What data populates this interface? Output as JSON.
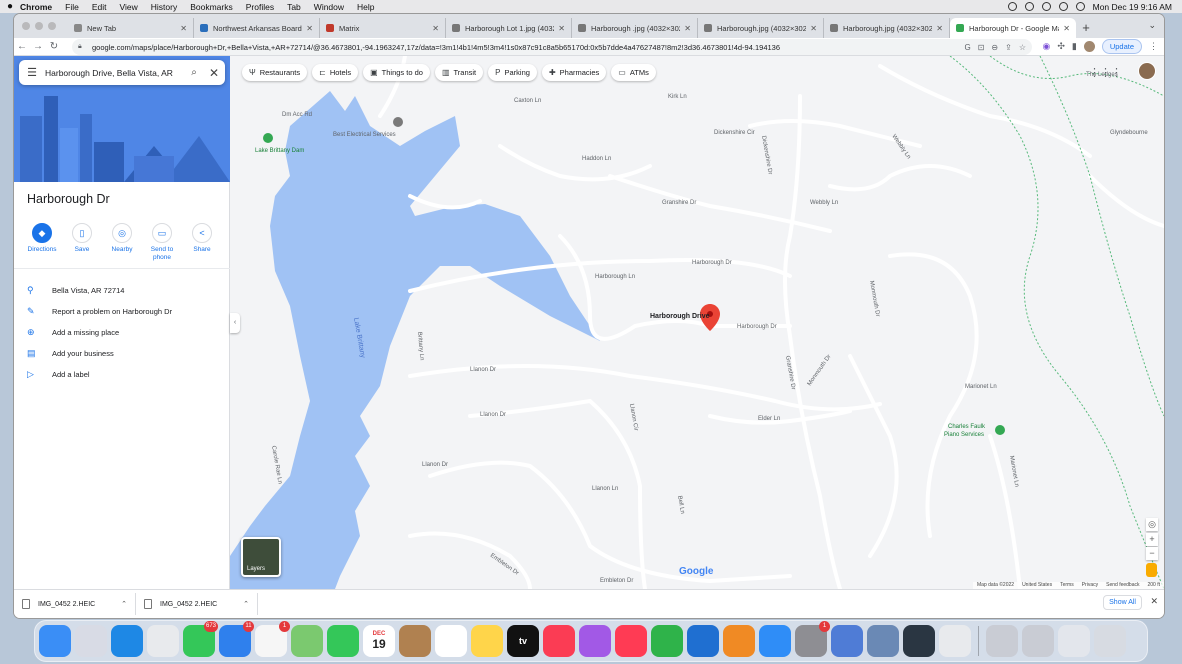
{
  "menubar": {
    "apple": "",
    "items": [
      "Chrome",
      "File",
      "Edit",
      "View",
      "History",
      "Bookmarks",
      "Profiles",
      "Tab",
      "Window",
      "Help"
    ],
    "clock": "Mon Dec 19  9:16 AM"
  },
  "browser": {
    "tabs": [
      {
        "title": "New Tab",
        "color": "#888888"
      },
      {
        "title": "Northwest Arkansas Board of R",
        "color": "#2a6ebb"
      },
      {
        "title": "Matrix",
        "color": "#c0392b"
      },
      {
        "title": "Harborough Lot 1.jpg (4032×3",
        "color": "#777777"
      },
      {
        "title": "Harborough .jpg (4032×3024)",
        "color": "#777777"
      },
      {
        "title": "Harborough.jpg (4032×3024)",
        "color": "#777777"
      },
      {
        "title": "Harborough.jpg (4032×3024)",
        "color": "#777777"
      },
      {
        "title": "Harborough Dr - Google Maps",
        "color": "#34a853",
        "active": true
      }
    ],
    "url": "google.com/maps/place/Harborough+Dr,+Bella+Vista,+AR+72714/@36.4673801,-94.1963247,17z/data=!3m1!4b1!4m5!3m4!1s0x87c91c8a5b65170d:0x5b7dde4a47627487!8m2!3d36.4673801!4d-94.194136",
    "update_label": "Update"
  },
  "maps": {
    "search_value": "Harborough Drive, Bella Vista, AR",
    "place_title": "Harborough Dr",
    "actions": [
      {
        "label": "Directions",
        "icon": "directions-icon",
        "glyph": "◆",
        "primary": true
      },
      {
        "label": "Save",
        "icon": "bookmark-icon",
        "glyph": "▯"
      },
      {
        "label": "Nearby",
        "icon": "nearby-icon",
        "glyph": "◎"
      },
      {
        "label": "Send to phone",
        "icon": "phone-icon",
        "glyph": "▭"
      },
      {
        "label": "Share",
        "icon": "share-icon",
        "glyph": "<"
      }
    ],
    "info": [
      {
        "label": "Bella Vista, AR 72714",
        "icon": "location-pin-icon",
        "glyph": "⚲"
      },
      {
        "label": "Report a problem on Harborough Dr",
        "icon": "pencil-icon",
        "glyph": "✎"
      },
      {
        "label": "Add a missing place",
        "icon": "add-place-icon",
        "glyph": "⊕"
      },
      {
        "label": "Add your business",
        "icon": "business-icon",
        "glyph": "▤"
      },
      {
        "label": "Add a label",
        "icon": "label-icon",
        "glyph": "▷"
      }
    ],
    "chips": [
      {
        "label": "Restaurants",
        "icon": "restaurant-icon",
        "glyph": "Ψ"
      },
      {
        "label": "Hotels",
        "icon": "hotel-icon",
        "glyph": "⊏"
      },
      {
        "label": "Things to do",
        "icon": "camera-icon",
        "glyph": "▣"
      },
      {
        "label": "Transit",
        "icon": "transit-icon",
        "glyph": "▥"
      },
      {
        "label": "Parking",
        "icon": "parking-icon",
        "glyph": "P"
      },
      {
        "label": "Pharmacies",
        "icon": "pharmacy-icon",
        "glyph": "✚"
      },
      {
        "label": "ATMs",
        "icon": "atm-icon",
        "glyph": "▭"
      }
    ],
    "map_labels": {
      "harborough_drive": "Harborough Drive",
      "harborough_dr": "Harborough Dr",
      "harborough_ln": "Harborough Ln",
      "lake_brittany": "Lake Brittany",
      "lake_brittany_dam": "Lake Brittany Dam",
      "best_electrical": "Best Electrical Services",
      "charles_faulk": "Charles Faulk",
      "piano_services": "Piano Services",
      "granshire_dr": "Granshire Dr",
      "granshire_dr2": "Granshire Dr",
      "haddon_ln": "Haddon Ln",
      "dickenshire_cir": "Dickenshire Cir",
      "dickenshire_dr": "Dickenshire Dr",
      "llanon_dr": "Llanon Dr",
      "llanon_dr2": "Llanon Dr",
      "llanon_dr3": "Llanon Dr",
      "llanon_ln": "Llanon Ln",
      "llanon_cir": "Llanon Cir",
      "elder_ln": "Elder Ln",
      "webbly_ln": "Webbly Ln",
      "webbly_ln2": "Webbly Ln",
      "monmouth_dr": "Monmouth Dr",
      "monmouth_dr2": "Monmouth Dr",
      "brittany_ln": "Brittany Ln",
      "embleton_dr": "Embleton Dr",
      "embleton_dr2": "Embleton Dr",
      "the_ledges": "The Ledges",
      "glyndebourne": "Glyndebourne",
      "caxton_ln": "Caxton Ln",
      "kirk_ln": "Kirk Ln",
      "dm_acc_rd": "Dm Acc Rd",
      "marionet_ln": "Marionet Ln",
      "marionet_ln2": "Marionet Ln",
      "belt_ln": "Bell Ln",
      "crystal_ln": "Carole Rae Ln"
    },
    "layers_label": "Layers",
    "attribution": [
      "Map data ©2022",
      "United States",
      "Terms",
      "Privacy",
      "Send feedback",
      "200 ft"
    ],
    "google_logo": "Google",
    "colors": {
      "water": "#a0c2f4",
      "road": "#ffffff",
      "land": "#f3f4f6",
      "pin": "#ea4335",
      "poi_green": "#34a853",
      "park_path": "#57b97b"
    }
  },
  "downloads": {
    "items": [
      "IMG_0452 2.HEIC",
      "IMG_0452 2.HEIC"
    ],
    "show_all": "Show All"
  },
  "dock": {
    "apps": [
      {
        "name": "Finder",
        "color": "#3a8ef6"
      },
      {
        "name": "Launchpad",
        "color": "#d8dbe5"
      },
      {
        "name": "Safari",
        "color": "#1e88e5"
      },
      {
        "name": "Chrome",
        "color": "#e8eaed"
      },
      {
        "name": "Messages",
        "color": "#34c759",
        "badge": "673"
      },
      {
        "name": "Mail",
        "color": "#2f80ed",
        "badge": "11"
      },
      {
        "name": "Photos",
        "color": "#f6f6f6",
        "badge": "1"
      },
      {
        "name": "Maps",
        "color": "#7bc96f"
      },
      {
        "name": "FaceTime",
        "color": "#34c759"
      },
      {
        "name": "Calendar",
        "color": "#ffffff",
        "month": "DEC",
        "day": "19"
      },
      {
        "name": "Contacts",
        "color": "#b08150"
      },
      {
        "name": "Reminders",
        "color": "#ffffff"
      },
      {
        "name": "Notes",
        "color": "#ffd54a"
      },
      {
        "name": "TV",
        "color": "#111111",
        "text": "tv"
      },
      {
        "name": "Music",
        "color": "#fb3c54"
      },
      {
        "name": "Podcasts",
        "color": "#a259e6"
      },
      {
        "name": "News",
        "color": "#ff3b54"
      },
      {
        "name": "Numbers",
        "color": "#2fb34a"
      },
      {
        "name": "Keynote",
        "color": "#1f6fd1"
      },
      {
        "name": "Pages",
        "color": "#f08a24"
      },
      {
        "name": "App Store",
        "color": "#2f8df7"
      },
      {
        "name": "System Preferences",
        "color": "#8e8e93",
        "badge": "1"
      },
      {
        "name": "Network Utility",
        "color": "#4f7cd6"
      },
      {
        "name": "Preview",
        "color": "#6a89b5"
      },
      {
        "name": "QuickTime",
        "color": "#2a3642"
      },
      {
        "name": "Chrome Apps",
        "color": "#e8eaed"
      },
      {
        "name": "Help",
        "color": "#c9ccd4"
      },
      {
        "name": "Help",
        "color": "#c9ccd4"
      },
      {
        "name": "Document",
        "color": "#e3e6ec"
      },
      {
        "name": "Trash",
        "color": "#d7dbe2"
      }
    ]
  }
}
